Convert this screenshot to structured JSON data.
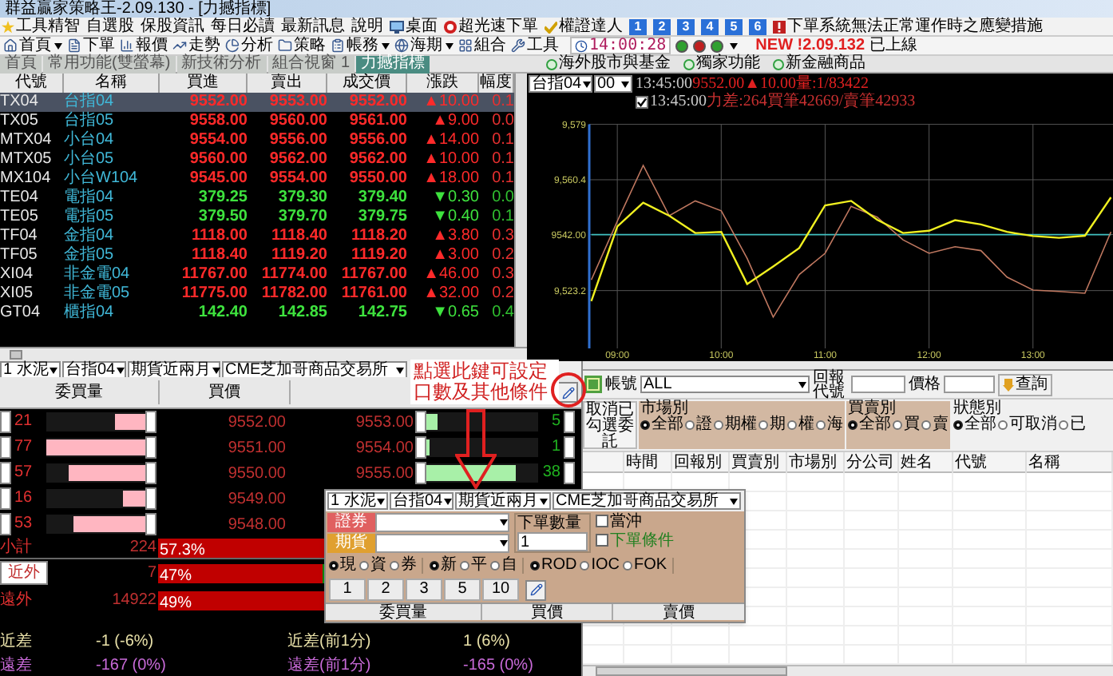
{
  "window": {
    "title": "群益贏家策略王-2.09.130 - [力撼指標]"
  },
  "menu": [
    {
      "label": "工具精智",
      "kind": "star"
    },
    {
      "label": "自選股",
      "kind": "plain"
    },
    {
      "label": "保股資訊",
      "kind": "plain"
    },
    {
      "label": "每日必讀",
      "kind": "plain"
    },
    {
      "label": "最新訊息",
      "kind": "plain"
    },
    {
      "label": "說明",
      "kind": "plain"
    },
    {
      "label": "桌面",
      "kind": "desktop"
    },
    {
      "label": "超光速下單",
      "kind": "stop"
    },
    {
      "label": "權證達人",
      "kind": "check"
    },
    {
      "label": "1",
      "kind": "number"
    },
    {
      "label": "2",
      "kind": "number"
    },
    {
      "label": "3",
      "kind": "number"
    },
    {
      "label": "4",
      "kind": "number"
    },
    {
      "label": "5",
      "kind": "number"
    },
    {
      "label": "6",
      "kind": "number"
    },
    {
      "label": "下單系統無法正常運作時之應變措施",
      "kind": "alert"
    }
  ],
  "toolbar": [
    {
      "label": "首頁",
      "dropdown": true
    },
    {
      "label": "下單",
      "dropdown": false
    },
    {
      "label": "報價",
      "dropdown": false
    },
    {
      "label": "走勢",
      "dropdown": false
    },
    {
      "label": "分析",
      "dropdown": false
    },
    {
      "label": "策略",
      "dropdown": false
    },
    {
      "label": "帳務",
      "dropdown": true
    },
    {
      "label": "海期",
      "dropdown": true
    },
    {
      "label": "組合",
      "dropdown": false
    },
    {
      "label": "工具",
      "dropdown": false
    }
  ],
  "clock": {
    "time": "14:00:28"
  },
  "notice": {
    "version": "NEW !2.09.132",
    "text": "已上線"
  },
  "tabs": [
    {
      "label": "首頁",
      "selected": false
    },
    {
      "label": "常用功能(雙螢幕)",
      "selected": false
    },
    {
      "label": "新技術分析",
      "selected": false
    },
    {
      "label": "組合視窗 1",
      "selected": false
    },
    {
      "label": "力撼指標",
      "selected": true
    }
  ],
  "links": [
    "海外股市與基金",
    "獨家功能",
    "新金融商品"
  ],
  "quotes": {
    "columns": [
      "代號",
      "名稱",
      "買進",
      "賣出",
      "成交價",
      "漲跌",
      "幅度"
    ],
    "rows": [
      {
        "code": "TX04",
        "name": "台指04",
        "bid": "9552.00",
        "ask": "9553.00",
        "last": "9552.00",
        "change": "▲10.00",
        "pct": "0.1",
        "kind": "up",
        "selected": true
      },
      {
        "code": "TX05",
        "name": "台指05",
        "bid": "9558.00",
        "ask": "9560.00",
        "last": "9561.00",
        "change": "▲9.00",
        "pct": "0.0",
        "kind": "up",
        "selected": false
      },
      {
        "code": "MTX04",
        "name": "小台04",
        "bid": "9554.00",
        "ask": "9556.00",
        "last": "9556.00",
        "change": "▲14.00",
        "pct": "0.1",
        "kind": "up",
        "selected": false
      },
      {
        "code": "MTX05",
        "name": "小台05",
        "bid": "9560.00",
        "ask": "9562.00",
        "last": "9562.00",
        "change": "▲10.00",
        "pct": "0.1",
        "kind": "up",
        "selected": false
      },
      {
        "code": "MX104",
        "name": "小台W104",
        "bid": "9545.00",
        "ask": "9554.00",
        "last": "9550.00",
        "change": "▲18.00",
        "pct": "0.1",
        "kind": "up",
        "selected": false
      },
      {
        "code": "TE04",
        "name": "電指04",
        "bid": "379.25",
        "ask": "379.30",
        "last": "379.40",
        "change": "▼0.30",
        "pct": "0.0",
        "kind": "down",
        "selected": false
      },
      {
        "code": "TE05",
        "name": "電指05",
        "bid": "379.50",
        "ask": "379.70",
        "last": "379.75",
        "change": "▼0.40",
        "pct": "0.1",
        "kind": "down",
        "selected": false
      },
      {
        "code": "TF04",
        "name": "金指04",
        "bid": "1118.00",
        "ask": "1118.40",
        "last": "1118.20",
        "change": "▲3.80",
        "pct": "0.3",
        "kind": "up",
        "selected": false
      },
      {
        "code": "TF05",
        "name": "金指05",
        "bid": "1118.40",
        "ask": "1119.20",
        "last": "1119.20",
        "change": "▲3.00",
        "pct": "0.2",
        "kind": "up",
        "selected": false
      },
      {
        "code": "XI04",
        "name": "非金電04",
        "bid": "11767.00",
        "ask": "11774.00",
        "last": "11767.00",
        "change": "▲46.00",
        "pct": "0.3",
        "kind": "up",
        "selected": false
      },
      {
        "code": "XI05",
        "name": "非金電05",
        "bid": "11775.00",
        "ask": "11782.00",
        "last": "11761.00",
        "change": "▲32.00",
        "pct": "0.2",
        "kind": "up",
        "selected": false
      },
      {
        "code": "GT04",
        "name": "櫃指04",
        "bid": "142.40",
        "ask": "142.85",
        "last": "142.75",
        "change": "▼0.65",
        "pct": "0.4",
        "kind": "down",
        "selected": false
      }
    ]
  },
  "chart": {
    "selects": [
      "台指04",
      "00"
    ],
    "line1": {
      "time": "13:45:00",
      "text": "9552.00▲10.00量:1/83422"
    },
    "line2": {
      "checked": true,
      "time": "13:45:00",
      "text": "力差:264買筆42669/賣筆42933"
    },
    "chart_data": {
      "type": "line",
      "grid": true,
      "x": [
        8.75,
        9,
        9.25,
        9.5,
        9.75,
        10,
        10.25,
        10.5,
        10.75,
        11,
        11.25,
        11.5,
        11.75,
        12,
        12.25,
        12.5,
        12.75,
        13,
        13.25,
        13.5,
        13.75
      ],
      "series": [
        {
          "color": "#40c0c0",
          "values": [
            9542,
            9542,
            9542,
            9542,
            9542,
            9542,
            9542,
            9542,
            9542,
            9542,
            9542,
            9542,
            9542,
            9542,
            9542,
            9542,
            9542,
            9542,
            9542,
            9542,
            9542
          ]
        },
        {
          "color": "#f0f020",
          "values": [
            9519.7,
            9544.7,
            9552.7,
            9548.3,
            9542.5,
            9542.9,
            9525.4,
            9531.3,
            9537.5,
            9551.8,
            9553.3,
            9547.0,
            9542.5,
            9543.3,
            9546.8,
            9545.4,
            9542.9,
            9541.5,
            9540.9,
            9541.6,
            9554.5
          ]
        },
        {
          "color": "#c07860",
          "values": [
            9526.8,
            9546.5,
            9565.2,
            9548.3,
            9553.3,
            9550.0,
            9534.0,
            9514.3,
            9528.6,
            9535.7,
            9551.5,
            9547.9,
            9540.2,
            9535.7,
            9537.9,
            9536.6,
            9527.7,
            9523.4,
            9522.9,
            9522.3,
            9542.9
          ]
        }
      ],
      "xlim": [
        8.73,
        13.77
      ],
      "ylim": [
        9503.8,
        9579
      ],
      "xticks": [
        {
          "value": 9,
          "label": "09:00"
        },
        {
          "value": 10,
          "label": "10:00"
        },
        {
          "value": 11,
          "label": "11:00"
        },
        {
          "value": 12,
          "label": "12:00"
        },
        {
          "value": 13,
          "label": "13:00"
        }
      ],
      "yticks": [
        {
          "value": 9579,
          "label": "9,579"
        },
        {
          "value": 9560.4,
          "label": "9,560.4"
        },
        {
          "value": 9542,
          "label": "9542.00"
        },
        {
          "value": 9523.2,
          "label": "9,523.2"
        }
      ]
    }
  },
  "selectors": [
    "1 水泥",
    "台指04",
    "期貨近兩月",
    "CME芝加哥商品交易所"
  ],
  "order_book": {
    "columns": [
      "委買量",
      "買價"
    ],
    "rows": [
      {
        "bid_qty": "21",
        "bid_bar": {
          "level": 0.3
        },
        "bid": "9552.00",
        "ask": "9553.00",
        "ask_bar": {
          "level": 0.1
        },
        "ask_qty": "5"
      },
      {
        "bid_qty": "77",
        "bid_bar": {
          "level": 1
        },
        "bid": "9551.00",
        "ask": "9554.00",
        "ask_bar": {
          "level": 0.03
        },
        "ask_qty": "1"
      },
      {
        "bid_qty": "57",
        "bid_bar": {
          "level": 0.78
        },
        "bid": "9550.00",
        "ask": "9555.00",
        "ask_bar": {
          "level": 0.8
        },
        "ask_qty": "38"
      },
      {
        "bid_qty": "16",
        "bid_bar": {
          "level": 0.22
        },
        "bid": "9549.00"
      },
      {
        "bid_qty": "53",
        "bid_bar": {
          "level": 0.72
        },
        "bid": "9548.00"
      }
    ],
    "summary": [
      {
        "label": "小計",
        "kind": "plain",
        "value": "224",
        "bar_text": "57.3%",
        "level": 0.573
      },
      {
        "label": "近外",
        "kind": "button",
        "value": "7",
        "bar_text": "47%",
        "level": 0.47
      },
      {
        "label": "遠外",
        "kind": "plain",
        "value": "14922",
        "bar_text": "49%",
        "level": 0.49
      }
    ],
    "diffs": [
      {
        "label": "近差",
        "value": "-1 (-6%)",
        "label2": "近差(前1分)",
        "value2": "1 (6%)",
        "color": "#e8e0a8"
      },
      {
        "label": "遠差",
        "value": "-167 (0%)",
        "label2": "遠差(前1分)",
        "value2": "-165 (0%)",
        "color": "#c86ad8"
      }
    ]
  },
  "callout": {
    "text": "點選此鍵可設定口數及其他條件"
  },
  "order_panel": {
    "selectors": [
      "1 水泥",
      "台指04",
      "期貨近兩月",
      "CME芝加哥商品交易所"
    ],
    "sec_label": "證券",
    "fut_label": "期貨",
    "qty_label": "下單數量",
    "qty": "1",
    "options": [
      {
        "label": "當沖",
        "checked": false,
        "kind": "plain"
      },
      {
        "label": "下單條件",
        "checked": false,
        "kind": "highlight"
      }
    ],
    "radio_groups": [
      [
        {
          "label": "現",
          "selected": true
        },
        {
          "label": "資",
          "selected": false
        },
        {
          "label": "券",
          "selected": false
        }
      ],
      [
        {
          "label": "新",
          "selected": true
        },
        {
          "label": "平",
          "selected": false
        },
        {
          "label": "自",
          "selected": false
        }
      ],
      [
        {
          "label": "ROD",
          "selected": true
        },
        {
          "label": "IOC",
          "selected": false
        },
        {
          "label": "FOK",
          "selected": false
        }
      ]
    ],
    "quick_qty": [
      "1",
      "2",
      "3",
      "5",
      "10"
    ],
    "columns": [
      "委買量",
      "買價",
      "賣價"
    ]
  },
  "query": {
    "account_label": "帳號",
    "account": "ALL",
    "code_label": "回報代號",
    "price_label": "價格",
    "search": "查詢",
    "cancel": "取消已勾選委託",
    "filters": [
      {
        "title": "市場別",
        "options": [
          {
            "label": "全部",
            "selected": true
          },
          {
            "label": "證",
            "selected": false
          },
          {
            "label": "期權",
            "selected": false
          },
          {
            "label": "期",
            "selected": false
          },
          {
            "label": "權",
            "selected": false
          },
          {
            "label": "海",
            "selected": false
          }
        ]
      },
      {
        "title": "買賣別",
        "options": [
          {
            "label": "全部",
            "selected": true
          },
          {
            "label": "買",
            "selected": false
          },
          {
            "label": "賣",
            "selected": false
          }
        ]
      },
      {
        "title": "狀態別",
        "options": [
          {
            "label": "全部",
            "selected": true
          },
          {
            "label": "可取消",
            "selected": false
          },
          {
            "label": "已",
            "selected": false
          }
        ]
      }
    ],
    "columns": [
      "時間",
      "回報別",
      "買賣別",
      "市場別",
      "分公司",
      "姓名",
      "代號",
      "名稱"
    ]
  }
}
